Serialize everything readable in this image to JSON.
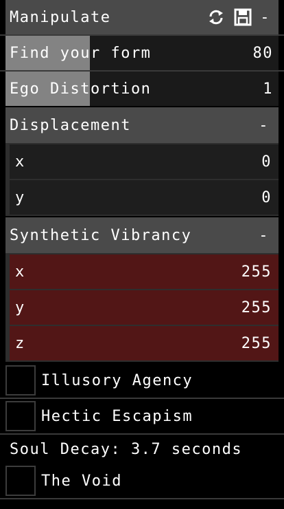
{
  "title": {
    "label": "Manipulate",
    "collapse": "-"
  },
  "sliders": [
    {
      "label": "Find your form",
      "value": "80",
      "fill_fraction": 0.31
    },
    {
      "label": "Ego Distortion",
      "value": "1",
      "fill_fraction": 0.31
    }
  ],
  "displacement": {
    "label": "Displacement",
    "collapse": "-",
    "items": [
      {
        "label": "x",
        "value": "0"
      },
      {
        "label": "y",
        "value": "0"
      }
    ]
  },
  "vibrancy": {
    "label": "Synthetic Vibrancy",
    "collapse": "-",
    "items": [
      {
        "label": "x",
        "value": "255"
      },
      {
        "label": "y",
        "value": "255"
      },
      {
        "label": "z",
        "value": "255"
      }
    ]
  },
  "toggles": [
    {
      "label": "Illusory Agency",
      "checked": false
    },
    {
      "label": "Hectic Escapism",
      "checked": false
    }
  ],
  "info": {
    "text": "Soul Decay: 3.7 seconds"
  },
  "void_toggle": {
    "label": "The Void",
    "checked": false
  },
  "colors": {
    "header": "#4a4a4a",
    "slider_fill": "#838383",
    "red_item": "#521616",
    "dark_item": "#1e1e1e"
  },
  "icons": [
    "refresh-icon",
    "save-icon"
  ]
}
